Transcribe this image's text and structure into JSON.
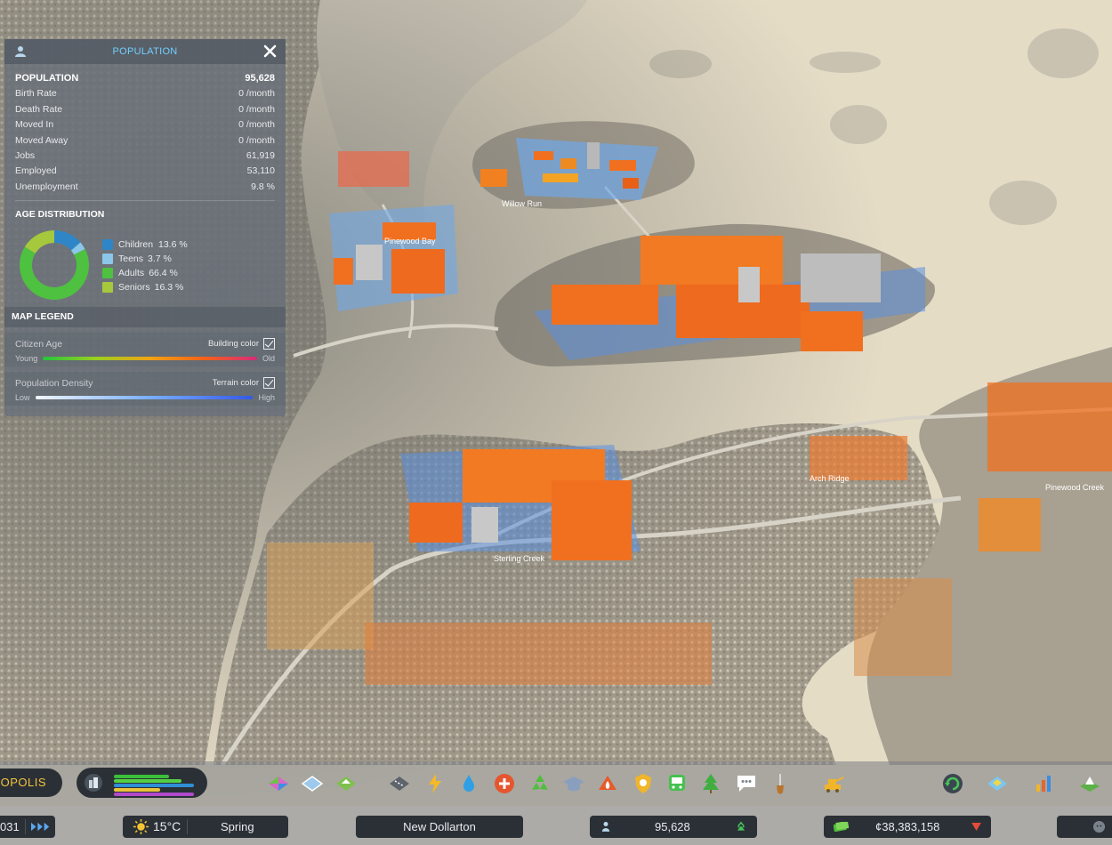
{
  "panel": {
    "title": "POPULATION",
    "stats": [
      {
        "label": "POPULATION",
        "value": "95,628"
      },
      {
        "label": "Birth Rate",
        "value": "0 /month"
      },
      {
        "label": "Death Rate",
        "value": "0 /month"
      },
      {
        "label": "Moved In",
        "value": "0 /month"
      },
      {
        "label": "Moved Away",
        "value": "0 /month"
      },
      {
        "label": "Jobs",
        "value": "61,919"
      },
      {
        "label": "Employed",
        "value": "53,110"
      },
      {
        "label": "Unemployment",
        "value": "9.8 %"
      }
    ],
    "age_title": "AGE DISTRIBUTION",
    "age_groups": [
      {
        "name": "Children",
        "value": "13.6 %",
        "percent": 13.6,
        "color": "#2f86c6"
      },
      {
        "name": "Teens",
        "value": "3.7 %",
        "percent": 3.7,
        "color": "#8cc6e8"
      },
      {
        "name": "Adults",
        "value": "66.4 %",
        "percent": 66.4,
        "color": "#4ec140"
      },
      {
        "name": "Seniors",
        "value": "16.3 %",
        "percent": 16.3,
        "color": "#a6c83c"
      }
    ],
    "legend_title": "MAP LEGEND",
    "legend": [
      {
        "name": "Citizen Age",
        "toggle": "Building color",
        "checked": true,
        "low": "Young",
        "high": "Old"
      },
      {
        "name": "Population Density",
        "toggle": "Terrain color",
        "checked": true,
        "low": "Low",
        "high": "High"
      }
    ]
  },
  "map_labels": [
    {
      "text": "Willow Run"
    },
    {
      "text": "Pinewood Bay"
    },
    {
      "text": "Sterling Creek"
    },
    {
      "text": "Arch Ridge"
    },
    {
      "text": "Pinewood Creek"
    }
  ],
  "toolbar": {
    "city_name": "ALOPOLIS",
    "tools": [
      "zoning-icon",
      "areas-icon",
      "landscaping-icon",
      "roads-icon",
      "electricity-icon",
      "water-icon",
      "healthcare-icon",
      "garbage-icon",
      "education-icon",
      "fire-icon",
      "police-icon",
      "transportation-icon",
      "parks-icon",
      "communications-icon",
      "landscaping-shovel-icon",
      "industry-icon",
      "refresh-icon",
      "map-icon",
      "statistics-icon",
      "city-icon"
    ]
  },
  "status": {
    "date_fragment": "031",
    "temperature": "15°C",
    "season": "Spring",
    "city": "New Dollarton",
    "population": "95,628",
    "money": "¢38,383,158",
    "colors": {
      "accent": "#6fd0ff",
      "money_down": "#e24b3b",
      "pop_up": "#47c35a"
    }
  }
}
